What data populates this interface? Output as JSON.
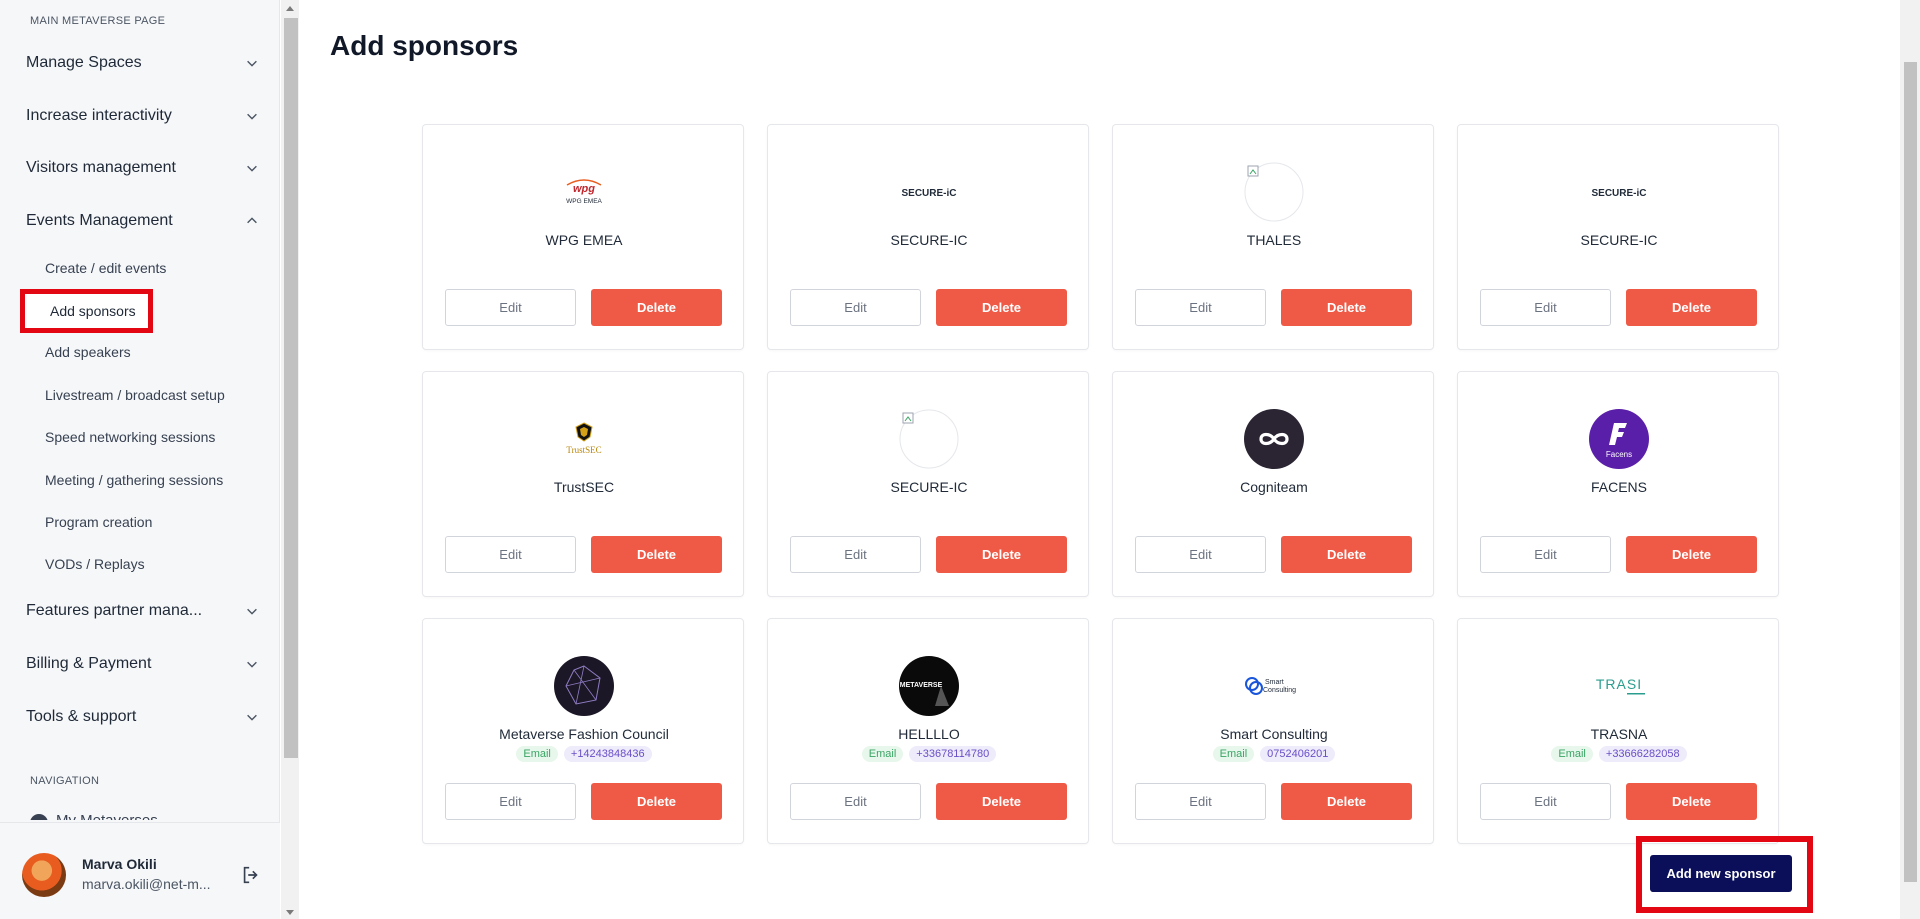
{
  "sidebar": {
    "section_main": "MAIN METAVERSE PAGE",
    "groups": [
      {
        "label": "Manage Spaces",
        "expanded": false
      },
      {
        "label": "Increase interactivity",
        "expanded": false
      },
      {
        "label": "Visitors management",
        "expanded": false
      },
      {
        "label": "Events Management",
        "expanded": true
      }
    ],
    "sub_items": [
      "Create / edit events",
      "Add sponsors",
      "Add speakers",
      "Livestream / broadcast setup",
      "Speed networking sessions",
      "Meeting / gathering sessions",
      "Program creation",
      "VODs / Replays"
    ],
    "active_item": "Add sponsors",
    "groups_after": [
      {
        "label": "Features partner mana..."
      },
      {
        "label": "Billing & Payment"
      },
      {
        "label": "Tools & support"
      }
    ],
    "section_nav": "NAVIGATION",
    "nav_partial": "My Metaverses"
  },
  "user": {
    "name": "Marva Okili",
    "email": "marva.okili@net-m..."
  },
  "page": {
    "title": "Add sponsors"
  },
  "buttons": {
    "edit": "Edit",
    "delete": "Delete",
    "add_new": "Add new sponsor"
  },
  "sponsors": [
    {
      "name": "WPG EMEA",
      "logo": "wpg-emea-logo"
    },
    {
      "name": "SECURE-IC",
      "logo": "secure-ic-logo"
    },
    {
      "name": "THALES",
      "logo": "broken-image"
    },
    {
      "name": "SECURE-IC",
      "logo": "secure-ic-logo"
    },
    {
      "name": "TrustSEC",
      "logo": "trustsec-logo"
    },
    {
      "name": "SECURE-IC",
      "logo": "broken-image"
    },
    {
      "name": "Cogniteam",
      "logo": "cogniteam-logo"
    },
    {
      "name": "FACENS",
      "logo": "facens-logo"
    },
    {
      "name": "Metaverse Fashion Council",
      "logo": "mfc-logo",
      "email_label": "Email",
      "phone": "+14243848436"
    },
    {
      "name": "HELLLLO",
      "logo": "metaverse-logo",
      "email_label": "Email",
      "phone": "+33678114780"
    },
    {
      "name": "Smart Consulting",
      "logo": "smart-consulting-logo",
      "email_label": "Email",
      "phone": "0752406201"
    },
    {
      "name": "TRASNA",
      "logo": "trasna-logo",
      "email_label": "Email",
      "phone": "+33666282058"
    }
  ],
  "logo_text": {
    "wpg_main": "wpg",
    "wpg_sub": "WPG EMEA",
    "secure_ic": "SECURE-iC",
    "trustsec": "TrustSEC",
    "facens": "Facens",
    "metaverse": "METAVERSE",
    "smart_1": "Smart",
    "smart_2": "Consulting",
    "trasna": "TRASI"
  },
  "colors": {
    "delete_bg": "#ef5a47",
    "add_bg": "#0b0f5a",
    "highlight": "#e30613"
  }
}
